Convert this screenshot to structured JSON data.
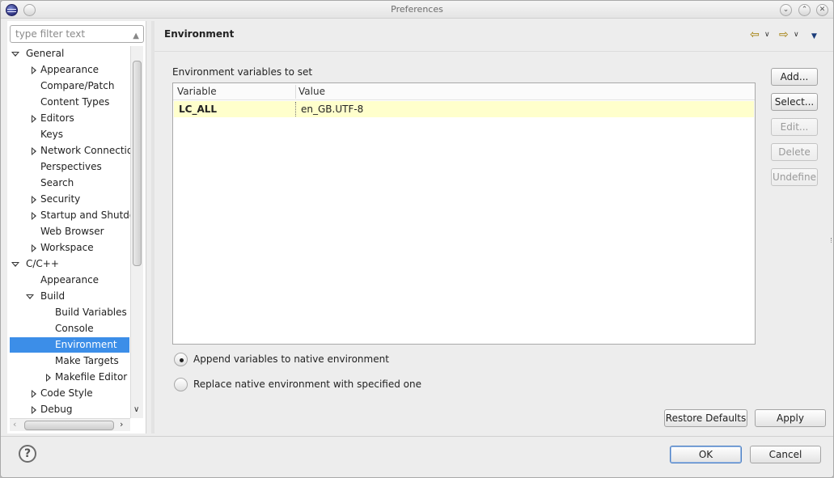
{
  "window": {
    "title": "Preferences",
    "minimize_glyph": "⌄",
    "maximize_glyph": "⌃",
    "close_glyph": "✕"
  },
  "filter": {
    "placeholder": "type filter text"
  },
  "tree": [
    {
      "label": "General",
      "level": 0,
      "expander": "open"
    },
    {
      "label": "Appearance",
      "level": 1,
      "expander": "closed"
    },
    {
      "label": "Compare/Patch",
      "level": 1,
      "expander": "none"
    },
    {
      "label": "Content Types",
      "level": 1,
      "expander": "none"
    },
    {
      "label": "Editors",
      "level": 1,
      "expander": "closed"
    },
    {
      "label": "Keys",
      "level": 1,
      "expander": "none"
    },
    {
      "label": "Network Connections",
      "level": 1,
      "expander": "closed"
    },
    {
      "label": "Perspectives",
      "level": 1,
      "expander": "none"
    },
    {
      "label": "Search",
      "level": 1,
      "expander": "none"
    },
    {
      "label": "Security",
      "level": 1,
      "expander": "closed"
    },
    {
      "label": "Startup and Shutdown",
      "level": 1,
      "expander": "closed"
    },
    {
      "label": "Web Browser",
      "level": 1,
      "expander": "none"
    },
    {
      "label": "Workspace",
      "level": 1,
      "expander": "closed"
    },
    {
      "label": "C/C++",
      "level": 0,
      "expander": "open"
    },
    {
      "label": "Appearance",
      "level": 1,
      "expander": "none"
    },
    {
      "label": "Build",
      "level": 1,
      "expander": "open"
    },
    {
      "label": "Build Variables",
      "level": 2,
      "expander": "none"
    },
    {
      "label": "Console",
      "level": 2,
      "expander": "none"
    },
    {
      "label": "Environment",
      "level": 2,
      "expander": "none",
      "selected": true
    },
    {
      "label": "Make Targets",
      "level": 2,
      "expander": "none"
    },
    {
      "label": "Makefile Editor",
      "level": 2,
      "expander": "closed"
    },
    {
      "label": "Code Style",
      "level": 1,
      "expander": "closed"
    },
    {
      "label": "Debug",
      "level": 1,
      "expander": "closed"
    }
  ],
  "page": {
    "title": "Environment",
    "section_label": "Environment variables to set",
    "columns": [
      "Variable",
      "Value"
    ],
    "rows": [
      {
        "variable": "LC_ALL",
        "value": "en_GB.UTF-8"
      }
    ],
    "side_buttons": [
      {
        "label": "Add...",
        "enabled": true
      },
      {
        "label": "Select...",
        "enabled": true
      },
      {
        "label": "Edit...",
        "enabled": false
      },
      {
        "label": "Delete",
        "enabled": false
      },
      {
        "label": "Undefine",
        "enabled": false
      }
    ],
    "options": [
      {
        "label": "Append variables to native environment",
        "checked": true
      },
      {
        "label": "Replace native environment with specified one",
        "checked": false
      }
    ],
    "restore_defaults_label": "Restore Defaults",
    "apply_label": "Apply"
  },
  "footer": {
    "help_glyph": "?",
    "ok_label": "OK",
    "cancel_label": "Cancel"
  },
  "icons": {
    "back": "back-arrow-icon",
    "forward": "forward-arrow-icon",
    "menu": "view-menu-icon",
    "help": "help-icon"
  }
}
